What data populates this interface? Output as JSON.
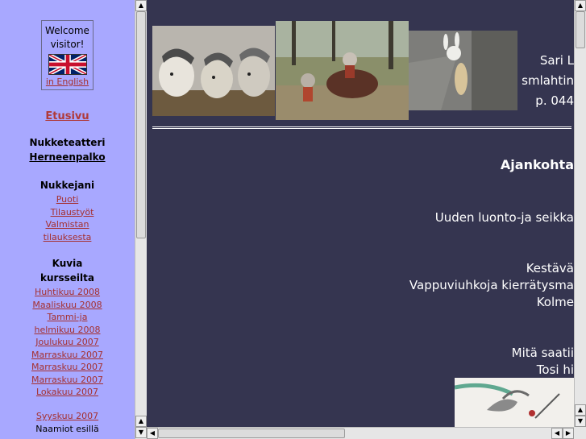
{
  "welcome": {
    "line1": "Welcome",
    "line2": "visitor!",
    "english_link": "in English"
  },
  "nav": {
    "home": "Etusivu",
    "theatre_line1": "Nukketeatteri",
    "theatre_line2": "Herneenpalko",
    "dolls_heading": "Nukkejani",
    "shop": "Puoti",
    "orders": "Tilaustyöt",
    "ready_line1": "Valmistan",
    "ready_line2": "tilauksesta",
    "pictures_line1": "Kuvia",
    "pictures_line2": "kursseilta",
    "courses": [
      "Huhtikuu 2008",
      "Maaliskuu 2008",
      "Tammi-ja",
      "helmikuu 2008",
      "Joulukuu 2007",
      "Marraskuu 2007",
      "Marraskuu 2007",
      "Marraskuu 2007",
      "Lokakuu 2007"
    ],
    "september": "Syyskuu 2007",
    "masks": "Naamiot esillä"
  },
  "main": {
    "contact_name": "Sari L",
    "contact_email": "smlahtin",
    "contact_phone": "p. 044",
    "news_heading": "Ajankohta",
    "line_nature": "Uuden luonto-ja seikka",
    "line_kestava": "Kestävä",
    "line_vappu": "Vappuviuhkoja kierrätysma",
    "line_kolme": "Kolme",
    "line_mita": "Mitä saatii",
    "line_tosi": "Tosi hi"
  },
  "colors": {
    "left_bg": "#a8a8ff",
    "main_bg": "#353550",
    "link": "#a53030"
  },
  "icons": {
    "flag": "uk-flag-icon",
    "scroll_up": "arrow-up-icon",
    "scroll_down": "arrow-down-icon",
    "scroll_left": "arrow-left-icon",
    "scroll_right": "arrow-right-icon"
  }
}
